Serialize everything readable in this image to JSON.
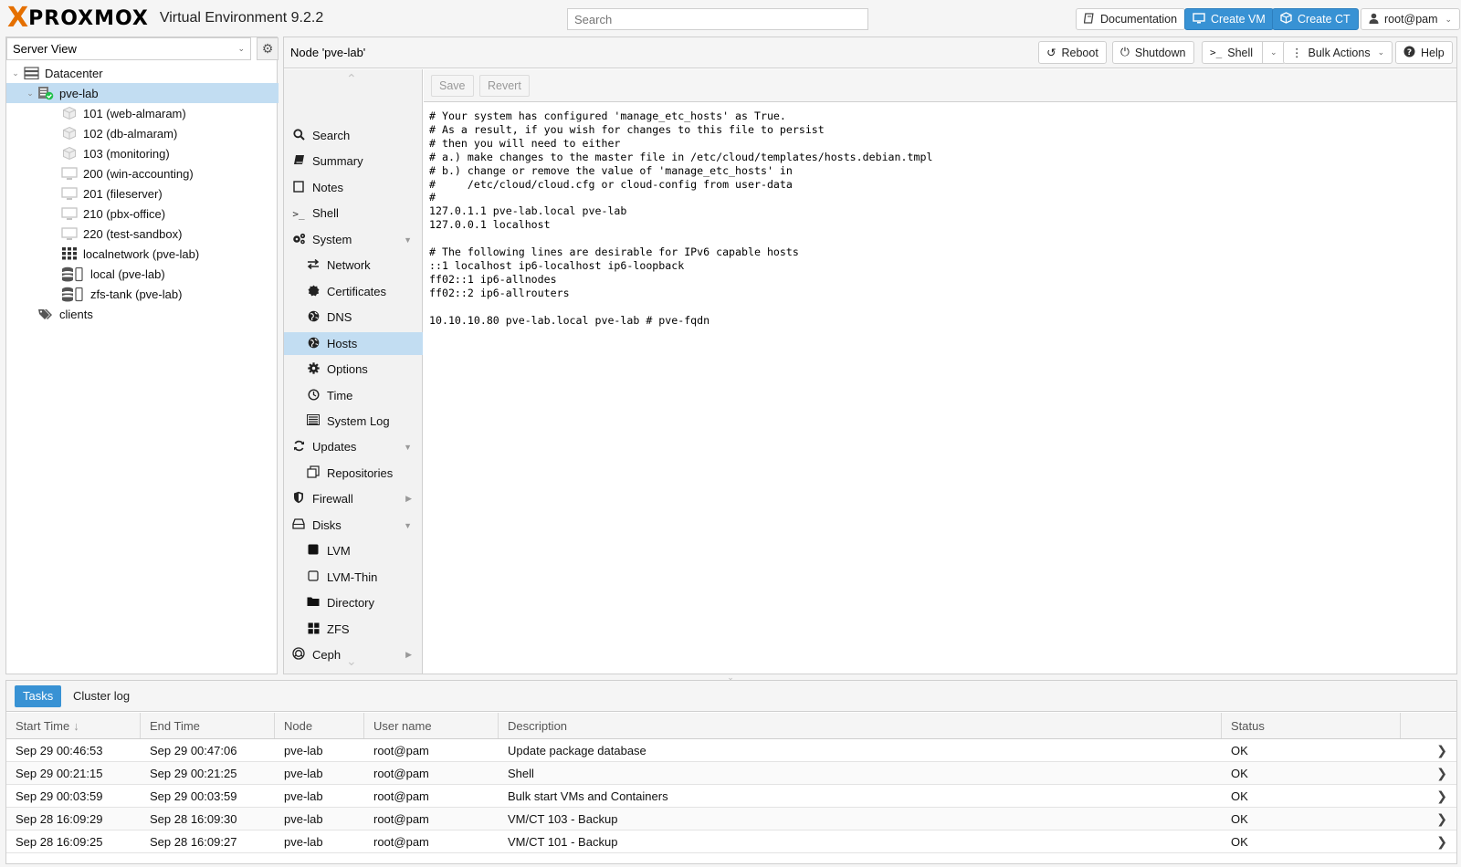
{
  "header": {
    "logo_x": "X",
    "logo_word": "PROXMOX",
    "product": "Virtual Environment 9.2.2",
    "search_placeholder": "Search",
    "documentation": "Documentation",
    "create_vm": "Create VM",
    "create_ct": "Create CT",
    "user": "root@pam"
  },
  "left": {
    "view": "Server View",
    "tree": [
      {
        "label": "Datacenter",
        "icon": "datacenter-icon",
        "level": 0
      },
      {
        "label": "pve-lab",
        "icon": "node-online-icon",
        "level": 1,
        "selected": true
      },
      {
        "label": "101 (web-almaram)",
        "icon": "container-icon",
        "level": 2
      },
      {
        "label": "102 (db-almaram)",
        "icon": "container-icon",
        "level": 2
      },
      {
        "label": "103 (monitoring)",
        "icon": "container-icon",
        "level": 2
      },
      {
        "label": "200 (win-accounting)",
        "icon": "vm-icon",
        "level": 2
      },
      {
        "label": "201 (fileserver)",
        "icon": "vm-icon",
        "level": 2
      },
      {
        "label": "210 (pbx-office)",
        "icon": "vm-icon",
        "level": 2
      },
      {
        "label": "220 (test-sandbox)",
        "icon": "vm-icon",
        "level": 2
      },
      {
        "label": "localnetwork (pve-lab)",
        "icon": "sdn-icon",
        "level": 2
      },
      {
        "label": "local (pve-lab)",
        "icon": "storage-icon",
        "level": 2
      },
      {
        "label": "zfs-tank (pve-lab)",
        "icon": "storage-icon",
        "level": 2
      },
      {
        "label": "clients",
        "icon": "tags-icon",
        "level": 1
      }
    ]
  },
  "content": {
    "title": "Node 'pve-lab'",
    "buttons": {
      "reboot": "Reboot",
      "shutdown": "Shutdown",
      "shell": "Shell",
      "bulk": "Bulk Actions",
      "help": "Help"
    },
    "menu": [
      {
        "label": "Search",
        "icon": "search-icon",
        "sub": false
      },
      {
        "label": "Summary",
        "icon": "book-icon",
        "sub": false
      },
      {
        "label": "Notes",
        "icon": "notes-icon",
        "sub": false
      },
      {
        "label": "Shell",
        "icon": "terminal-icon",
        "sub": false
      },
      {
        "label": "System",
        "icon": "cogs-icon",
        "sub": false,
        "arrow": "down"
      },
      {
        "label": "Network",
        "icon": "network-icon",
        "sub": true
      },
      {
        "label": "Certificates",
        "icon": "certificate-icon",
        "sub": true
      },
      {
        "label": "DNS",
        "icon": "globe-icon",
        "sub": true
      },
      {
        "label": "Hosts",
        "icon": "globe-icon",
        "sub": true,
        "selected": true
      },
      {
        "label": "Options",
        "icon": "gear-icon",
        "sub": true
      },
      {
        "label": "Time",
        "icon": "clock-icon",
        "sub": true
      },
      {
        "label": "System Log",
        "icon": "list-icon",
        "sub": true
      },
      {
        "label": "Updates",
        "icon": "refresh-icon",
        "sub": false,
        "arrow": "down"
      },
      {
        "label": "Repositories",
        "icon": "files-icon",
        "sub": true
      },
      {
        "label": "Firewall",
        "icon": "shield-icon",
        "sub": false,
        "arrow": "right"
      },
      {
        "label": "Disks",
        "icon": "hdd-icon",
        "sub": false,
        "arrow": "down"
      },
      {
        "label": "LVM",
        "icon": "square-icon",
        "sub": true
      },
      {
        "label": "LVM-Thin",
        "icon": "square-outline-icon",
        "sub": true
      },
      {
        "label": "Directory",
        "icon": "folder-icon",
        "sub": true
      },
      {
        "label": "ZFS",
        "icon": "th-large-icon",
        "sub": true
      },
      {
        "label": "Ceph",
        "icon": "ceph-icon",
        "sub": false,
        "arrow": "right"
      }
    ],
    "editor": {
      "save": "Save",
      "revert": "Revert",
      "text": "# Your system has configured 'manage_etc_hosts' as True.\n# As a result, if you wish for changes to this file to persist\n# then you will need to either\n# a.) make changes to the master file in /etc/cloud/templates/hosts.debian.tmpl\n# b.) change or remove the value of 'manage_etc_hosts' in\n#     /etc/cloud/cloud.cfg or cloud-config from user-data\n#\n127.0.1.1 pve-lab.local pve-lab\n127.0.0.1 localhost\n\n# The following lines are desirable for IPv6 capable hosts\n::1 localhost ip6-localhost ip6-loopback\nff02::1 ip6-allnodes\nff02::2 ip6-allrouters\n\n10.10.10.80 pve-lab.local pve-lab # pve-fqdn"
    }
  },
  "bottom": {
    "tabs": [
      "Tasks",
      "Cluster log"
    ],
    "columns": [
      "Start Time",
      "End Time",
      "Node",
      "User name",
      "Description",
      "Status"
    ],
    "sort_indicator": "↓",
    "rows": [
      [
        "Sep 29 00:46:53",
        "Sep 29 00:47:06",
        "pve-lab",
        "root@pam",
        "Update package database",
        "OK"
      ],
      [
        "Sep 29 00:21:15",
        "Sep 29 00:21:25",
        "pve-lab",
        "root@pam",
        "Shell",
        "OK"
      ],
      [
        "Sep 29 00:03:59",
        "Sep 29 00:03:59",
        "pve-lab",
        "root@pam",
        "Bulk start VMs and Containers",
        "OK"
      ],
      [
        "Sep 28 16:09:29",
        "Sep 28 16:09:30",
        "pve-lab",
        "root@pam",
        "VM/CT 103 - Backup",
        "OK"
      ],
      [
        "Sep 28 16:09:25",
        "Sep 28 16:09:27",
        "pve-lab",
        "root@pam",
        "VM/CT 101 - Backup",
        "OK"
      ]
    ]
  },
  "colors": {
    "accent": "#3892d4",
    "selection": "#c2ddf2",
    "logo_orange": "#e57000"
  }
}
